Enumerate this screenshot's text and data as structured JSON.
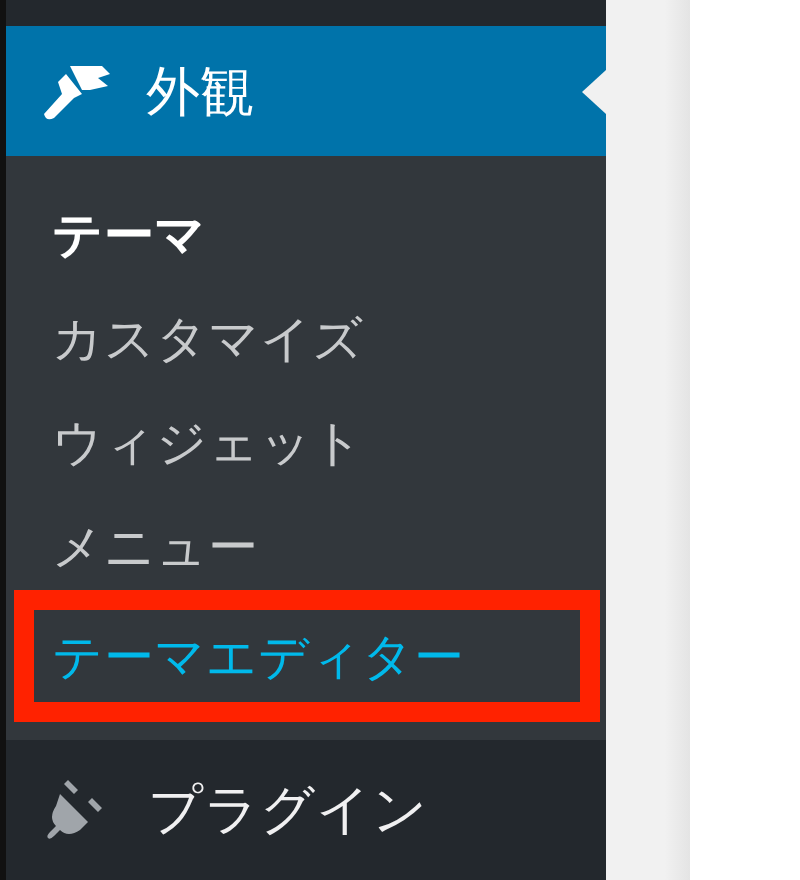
{
  "menu": {
    "active_item": {
      "label": "外観"
    },
    "submenu": [
      {
        "label": "テーマ",
        "selected": true,
        "highlighted": false
      },
      {
        "label": "カスタマイズ",
        "selected": false,
        "highlighted": false
      },
      {
        "label": "ウィジェット",
        "selected": false,
        "highlighted": false
      },
      {
        "label": "メニュー",
        "selected": false,
        "highlighted": false
      },
      {
        "label": "テーマエディター",
        "selected": false,
        "highlighted": true
      }
    ],
    "next_item": {
      "label": "プラグイン"
    }
  }
}
